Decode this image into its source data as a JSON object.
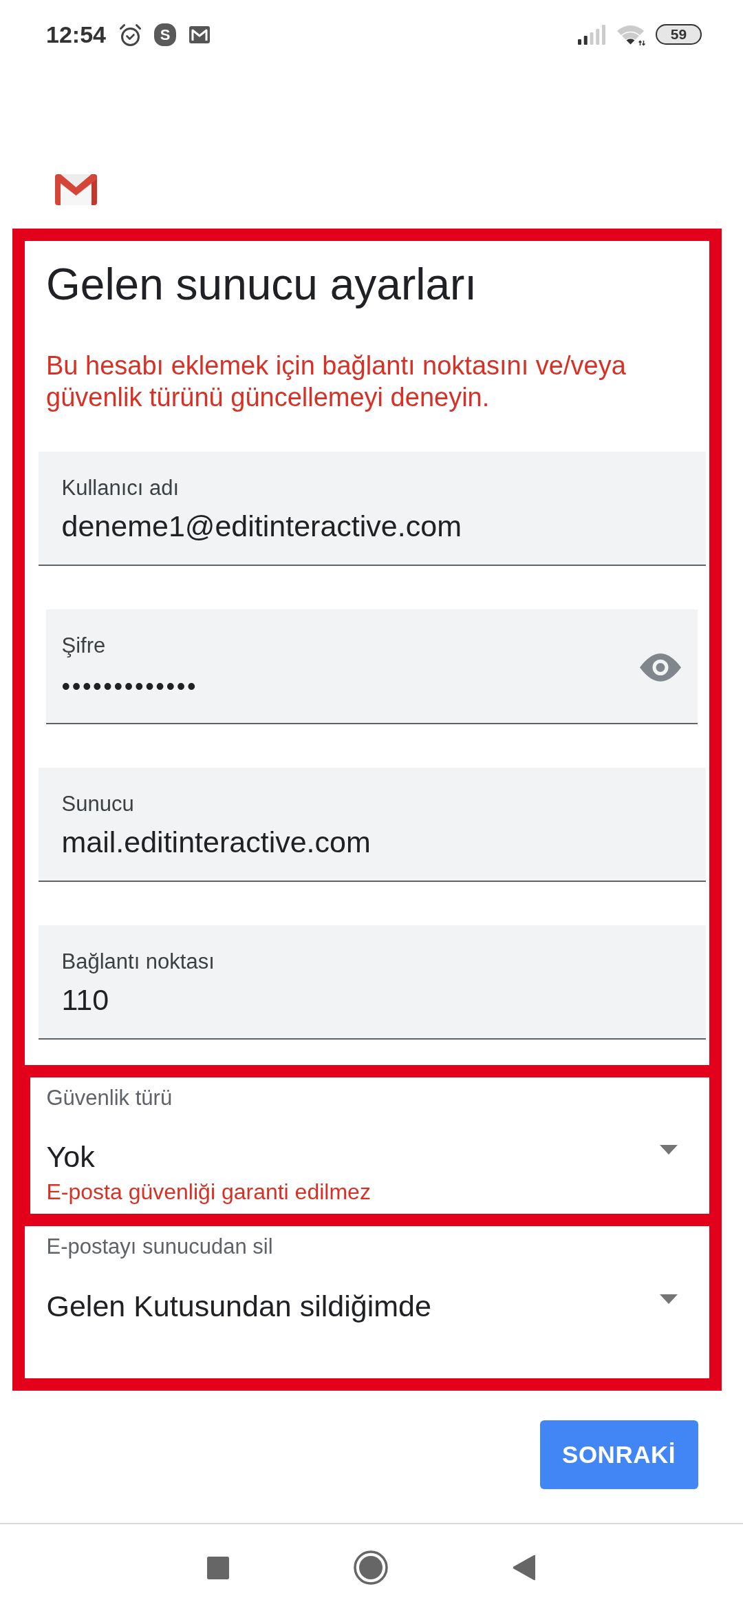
{
  "status_bar": {
    "time": "12:54",
    "app_badge": "S",
    "battery": "59"
  },
  "sections": [
    {
      "highlighted": true,
      "title": "Gelen sunucu ayarları",
      "message": "Bu hesabı eklemek için bağlantı noktasını ve/veya güvenlik türünü güncellemeyi deneyin.",
      "fields": [
        {
          "kind": "text",
          "label": "Kullanıcı adı",
          "value": "deneme1@editinteractive.com"
        },
        {
          "kind": "password",
          "label": "Şifre",
          "value": "•••••••••••••"
        },
        {
          "kind": "text",
          "label": "Sunucu",
          "value": "mail.editinteractive.com"
        },
        {
          "kind": "text",
          "label": "Bağlantı noktası",
          "value": "110"
        }
      ]
    },
    {
      "highlighted": true,
      "fields": [
        {
          "kind": "dropdown",
          "label": "Güvenlik türü",
          "value": "Yok",
          "error": "E-posta güvenliği garanti edilmez"
        }
      ]
    },
    {
      "highlighted": true,
      "fields": [
        {
          "kind": "dropdown",
          "label": "E-postayı sunucudan sil",
          "value": "Gelen Kutusundan sildiğimde"
        }
      ]
    }
  ],
  "next_button": "SONRAKİ"
}
